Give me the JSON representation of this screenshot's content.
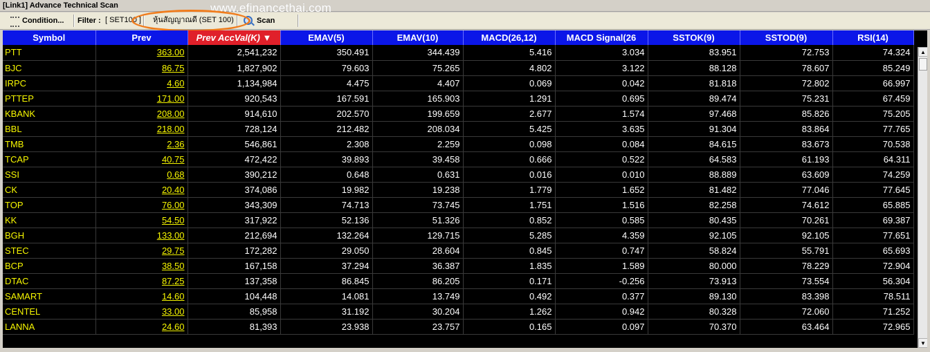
{
  "window": {
    "title": "[Link1] Advance Technical Scan",
    "watermark": "www.efinancethai.com"
  },
  "toolbar": {
    "condition_label": "Condition...",
    "filter_label": "Filter :",
    "filter_select_value": "[ SET100 ]",
    "filter_display_value": "หุ้นสัญญาณดี (SET 100)",
    "scan_label": "Scan",
    "highlight_color": "#f07c1c"
  },
  "table": {
    "header_color": "#0b16e8",
    "sorted_header_color": "#e0202a",
    "columns": [
      "Symbol",
      "Prev",
      "Prev AccVal(K) ▼",
      "EMAV(5)",
      "EMAV(10)",
      "MACD(26,12)",
      "MACD Signal(26",
      "SSTOK(9)",
      "SSTOD(9)",
      "RSI(14)"
    ],
    "rows": [
      [
        "PTT",
        "363.00",
        "2,541,232",
        "350.491",
        "344.439",
        "5.416",
        "3.034",
        "83.951",
        "72.753",
        "74.324"
      ],
      [
        "BJC",
        "86.75",
        "1,827,902",
        "79.603",
        "75.265",
        "4.802",
        "3.122",
        "88.128",
        "78.607",
        "85.249"
      ],
      [
        "IRPC",
        "4.60",
        "1,134,984",
        "4.475",
        "4.407",
        "0.069",
        "0.042",
        "81.818",
        "72.802",
        "66.997"
      ],
      [
        "PTTEP",
        "171.00",
        "920,543",
        "167.591",
        "165.903",
        "1.291",
        "0.695",
        "89.474",
        "75.231",
        "67.459"
      ],
      [
        "KBANK",
        "208.00",
        "914,610",
        "202.570",
        "199.659",
        "2.677",
        "1.574",
        "97.468",
        "85.826",
        "75.205"
      ],
      [
        "BBL",
        "218.00",
        "728,124",
        "212.482",
        "208.034",
        "5.425",
        "3.635",
        "91.304",
        "83.864",
        "77.765"
      ],
      [
        "TMB",
        "2.36",
        "546,861",
        "2.308",
        "2.259",
        "0.098",
        "0.084",
        "84.615",
        "83.673",
        "70.538"
      ],
      [
        "TCAP",
        "40.75",
        "472,422",
        "39.893",
        "39.458",
        "0.666",
        "0.522",
        "64.583",
        "61.193",
        "64.311"
      ],
      [
        "SSI",
        "0.68",
        "390,212",
        "0.648",
        "0.631",
        "0.016",
        "0.010",
        "88.889",
        "63.609",
        "74.259"
      ],
      [
        "CK",
        "20.40",
        "374,086",
        "19.982",
        "19.238",
        "1.779",
        "1.652",
        "81.482",
        "77.046",
        "77.645"
      ],
      [
        "TOP",
        "76.00",
        "343,309",
        "74.713",
        "73.745",
        "1.751",
        "1.516",
        "82.258",
        "74.612",
        "65.885"
      ],
      [
        "KK",
        "54.50",
        "317,922",
        "52.136",
        "51.326",
        "0.852",
        "0.585",
        "80.435",
        "70.261",
        "69.387"
      ],
      [
        "BGH",
        "133.00",
        "212,694",
        "132.264",
        "129.715",
        "5.285",
        "4.359",
        "92.105",
        "92.105",
        "77.651"
      ],
      [
        "STEC",
        "29.75",
        "172,282",
        "29.050",
        "28.604",
        "0.845",
        "0.747",
        "58.824",
        "55.791",
        "65.693"
      ],
      [
        "BCP",
        "38.50",
        "167,158",
        "37.294",
        "36.387",
        "1.835",
        "1.589",
        "80.000",
        "78.229",
        "72.904"
      ],
      [
        "DTAC",
        "87.25",
        "137,358",
        "86.845",
        "86.205",
        "0.171",
        "-0.256",
        "73.913",
        "73.554",
        "56.304"
      ],
      [
        "SAMART",
        "14.60",
        "104,448",
        "14.081",
        "13.749",
        "0.492",
        "0.377",
        "89.130",
        "83.398",
        "78.511"
      ],
      [
        "CENTEL",
        "33.00",
        "85,958",
        "31.192",
        "30.204",
        "1.262",
        "0.942",
        "80.328",
        "72.060",
        "71.252"
      ],
      [
        "LANNA",
        "24.60",
        "81,393",
        "23.938",
        "23.757",
        "0.165",
        "0.097",
        "70.370",
        "63.464",
        "72.965"
      ]
    ]
  }
}
